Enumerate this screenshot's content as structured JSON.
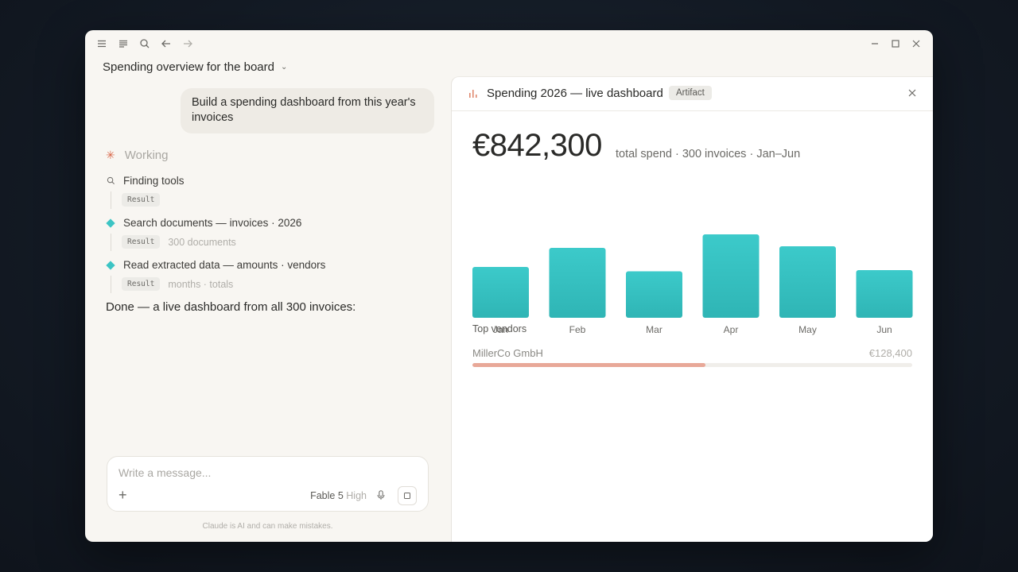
{
  "window": {
    "title_bar": {
      "icons": [
        "menu-icon",
        "list-icon",
        "search-icon",
        "back-arrow-icon",
        "forward-arrow-icon",
        "minimize-icon",
        "maximize-icon",
        "close-icon"
      ]
    }
  },
  "conversation": {
    "title": "Spending overview for the board",
    "user_message": "Build a spending dashboard from this year's invoices",
    "status_label": "Working",
    "steps": [
      {
        "label": "Finding tools",
        "result_tag": "Result",
        "result_text": ""
      },
      {
        "label": "Search documents — invoices · 2026",
        "result_tag": "Result",
        "result_text": "300 documents"
      },
      {
        "label": "Read extracted data — amounts · vendors",
        "result_tag": "Result",
        "result_text": "months · totals"
      }
    ],
    "done_message": "Done — a live dashboard from all 300 invoices:"
  },
  "composer": {
    "placeholder": "Write a message...",
    "model_name": "Fable 5",
    "effort": "High",
    "disclaimer": "Claude is AI and can make mistakes."
  },
  "artifact": {
    "title": "Spending 2026 — live dashboard",
    "badge": "Artifact",
    "total": "€842,300",
    "summary": "total spend · 300 invoices · Jan–Jun",
    "vendors_heading": "Top vendors",
    "vendors": [
      {
        "name": "MillerCo GmbH",
        "value": "€128,400",
        "share": 0.53
      }
    ]
  },
  "chart_data": {
    "type": "bar",
    "categories": [
      "Jan",
      "Feb",
      "Mar",
      "Apr",
      "May",
      "Jun"
    ],
    "values": [
      128000,
      176000,
      117000,
      210000,
      180000,
      120000
    ],
    "title": "",
    "xlabel": "",
    "ylabel": "",
    "grid": false,
    "bar_color": "#35c1c1"
  },
  "colors": {
    "accent": "#35c1c1",
    "vendor_bar": "#e8a898",
    "spark": "#d9684a"
  }
}
